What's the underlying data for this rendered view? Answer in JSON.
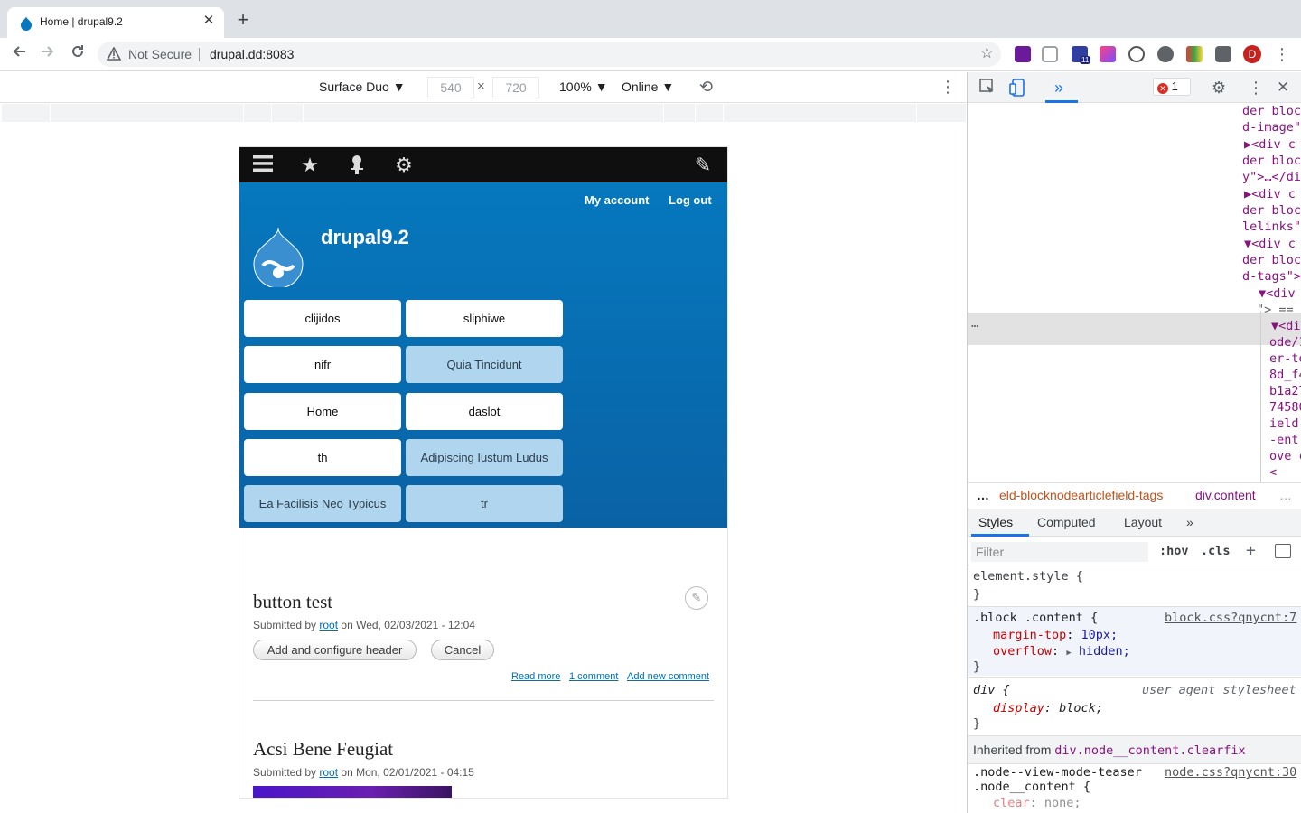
{
  "browser": {
    "tab_title": "Home | drupal9.2",
    "close_glyph": "✕",
    "new_tab_glyph": "+",
    "security_label": "Not Secure",
    "url": "drupal.dd:8083",
    "extension_badge": "11",
    "profile_initial": "D"
  },
  "device_toolbar": {
    "device": "Surface Duo ▼",
    "width": "540",
    "height": "720",
    "times": "×",
    "zoom": "100% ▼",
    "network": "Online ▼"
  },
  "site": {
    "secondary_menu": [
      "My account",
      "Log out"
    ],
    "site_name": "drupal9.2",
    "menu_items": [
      {
        "label": "clijidos",
        "active": false
      },
      {
        "label": "sliphiwe",
        "active": false
      },
      {
        "label": "nifr",
        "active": false
      },
      {
        "label": "Quia Tincidunt",
        "active": true
      },
      {
        "label": "Home",
        "active": false
      },
      {
        "label": "daslot",
        "active": false
      },
      {
        "label": "th",
        "active": false
      },
      {
        "label": "Adipiscing Iustum Ludus",
        "active": true
      },
      {
        "label": "Ea Facilisis Neo Typicus",
        "active": true
      },
      {
        "label": "tr",
        "active": true
      }
    ],
    "articles": [
      {
        "title": "button test",
        "submitted_prefix": "Submitted by ",
        "author": "root",
        "submitted_suffix": " on Wed, 02/03/2021 - 12:04",
        "buttons": [
          "Add and configure header",
          "Cancel"
        ],
        "links": [
          "Read more",
          "1 comment",
          "Add new comment"
        ]
      },
      {
        "title": "Acsi Bene Feugiat",
        "submitted_prefix": "Submitted by ",
        "author": "root",
        "submitted_suffix": " on Mon, 02/01/2021 - 04:15"
      }
    ]
  },
  "devtools": {
    "error_count": "1",
    "more_tabs": "»",
    "elements_lines": [
      {
        "text": "der bloc",
        "cls": "attr"
      },
      {
        "text": "d-image\"",
        "cls": "attr"
      },
      {
        "text": "▶<div c",
        "cls": "tag"
      },
      {
        "text": "der bloc",
        "cls": "attr"
      },
      {
        "text": "y\">…</di",
        "cls": "attr"
      },
      {
        "text": "▶<div c",
        "cls": "tag"
      },
      {
        "text": "der bloc",
        "cls": "attr"
      },
      {
        "text": "lelinks\"",
        "cls": "attr"
      },
      {
        "text": "▼<div c",
        "cls": "tag"
      },
      {
        "text": "der bloc",
        "cls": "attr"
      },
      {
        "text": "d-tags\">",
        "cls": "attr"
      }
    ],
    "selected_lines": [
      "▼<div",
      "\"> =="
    ],
    "selected_ellipsis": "…",
    "child_lines": [
      "▼<di",
      "ode/1",
      "er-te",
      "8d_f4",
      "b1a27",
      "74580",
      "ield-",
      "-ent",
      "ove c",
      "<"
    ],
    "breadcrumb_ellipsis": "…",
    "breadcrumb_more": "…",
    "breadcrumbs": [
      "eld-blocknodearticlefield-tags",
      "div.content"
    ],
    "panel_tabs": [
      "Styles",
      "Computed",
      "Layout",
      "»"
    ],
    "filter_placeholder": "Filter",
    "hov": ":hov",
    "cls": ".cls",
    "element_style": "element.style {",
    "block_selector": ".block .content {",
    "block_source": "block.css?qnycnt:7",
    "decl1_prop": "margin-top",
    "decl1_val": " 10px;",
    "decl2_prop": "overflow",
    "decl2_val": " hidden;",
    "div_selector": "div {",
    "ua_label": "user agent stylesheet",
    "display_prop": "display",
    "display_val": " block;",
    "inherited_prefix": "Inherited from ",
    "inherited_from": "div.node__content.clearfix",
    "node_selector_1": ".node--view-mode-teaser",
    "node_selector_2": ".node__content {",
    "node_source": "node.css?qnycnt:30",
    "clear_prop": "clear",
    "clear_val": " none;",
    "brace_close": "}",
    "colon": ":",
    "overflow_arrow": "▶"
  },
  "colors": {
    "header_blue": "#0678be",
    "menu_active": "#b0d5ef",
    "link_blue": "#0071b3",
    "devtools_accent": "#1a73e8"
  }
}
